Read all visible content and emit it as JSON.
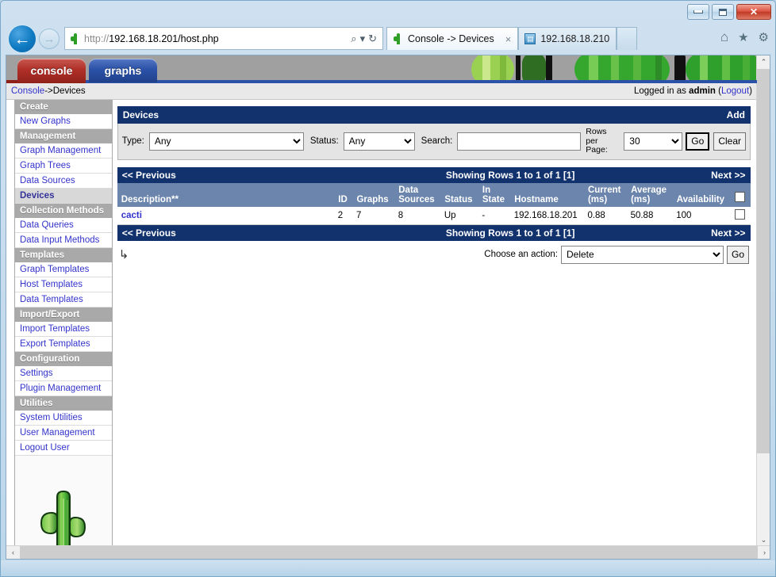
{
  "window": {
    "minimize_label": "Minimize",
    "restore_label": "Restore",
    "close_label": "Close"
  },
  "browser": {
    "back_glyph": "←",
    "forward_glyph": "→",
    "address_scheme": "http://",
    "address_rest": "192.168.18.201/host.php",
    "search_glyph": "⌕",
    "dropdown_glyph": "▾",
    "refresh_glyph": "↻",
    "home_glyph": "⌂",
    "favorites_glyph": "★",
    "settings_glyph": "⚙",
    "tabs": [
      {
        "title": "Console -> Devices",
        "close_glyph": "×",
        "favicon": "cactus-icon",
        "active": true
      },
      {
        "title": "192.168.18.210",
        "close_glyph": "",
        "favicon": "page-icon",
        "active": false
      }
    ]
  },
  "app": {
    "tabs": [
      {
        "label": "console",
        "color": "#b03028"
      },
      {
        "label": "graphs",
        "color": "#2b52a8"
      }
    ],
    "breadcrumb": {
      "root": "Console",
      "separator": " -> ",
      "current": "Devices"
    },
    "login": {
      "prefix": "Logged in as ",
      "user": "admin",
      "logout_open": " (",
      "logout": "Logout",
      "logout_close": ")"
    }
  },
  "sidebar": {
    "sections": [
      {
        "header": "Create",
        "items": [
          {
            "label": "New Graphs",
            "selected": false
          }
        ]
      },
      {
        "header": "Management",
        "items": [
          {
            "label": "Graph Management",
            "selected": false
          },
          {
            "label": "Graph Trees",
            "selected": false
          },
          {
            "label": "Data Sources",
            "selected": false
          },
          {
            "label": "Devices",
            "selected": true
          }
        ]
      },
      {
        "header": "Collection Methods",
        "items": [
          {
            "label": "Data Queries",
            "selected": false
          },
          {
            "label": "Data Input Methods",
            "selected": false
          }
        ]
      },
      {
        "header": "Templates",
        "items": [
          {
            "label": "Graph Templates",
            "selected": false
          },
          {
            "label": "Host Templates",
            "selected": false
          },
          {
            "label": "Data Templates",
            "selected": false
          }
        ]
      },
      {
        "header": "Import/Export",
        "items": [
          {
            "label": "Import Templates",
            "selected": false
          },
          {
            "label": "Export Templates",
            "selected": false
          }
        ]
      },
      {
        "header": "Configuration",
        "items": [
          {
            "label": "Settings",
            "selected": false
          },
          {
            "label": "Plugin Management",
            "selected": false
          }
        ]
      },
      {
        "header": "Utilities",
        "items": [
          {
            "label": "System Utilities",
            "selected": false
          },
          {
            "label": "User Management",
            "selected": false
          },
          {
            "label": "Logout User",
            "selected": false
          }
        ]
      }
    ]
  },
  "main": {
    "panel_title": "Devices",
    "add_label": "Add",
    "filter": {
      "type_label": "Type:",
      "type_value": "Any",
      "status_label": "Status:",
      "status_value": "Any",
      "search_label": "Search:",
      "search_value": "",
      "search_placeholder": "",
      "rows_per_page_label": "Rows per Page:",
      "rows_per_page_value": "30",
      "go_label": "Go",
      "clear_label": "Clear"
    },
    "pager": {
      "previous": "<< Previous",
      "showing": "Showing Rows 1 to 1 of 1 [1]",
      "next": "Next >>"
    },
    "table": {
      "columns": [
        "Description**",
        "ID",
        "Graphs",
        "Data Sources",
        "Status",
        "In State",
        "Hostname",
        "Current (ms)",
        "Average (ms)",
        "Availability"
      ],
      "rows": [
        {
          "description": "cacti",
          "id": "2",
          "graphs": "7",
          "data_sources": "8",
          "status": "Up",
          "in_state": "-",
          "hostname": "192.168.18.201",
          "current_ms": "0.88",
          "average_ms": "50.88",
          "availability": "100",
          "checked": false
        }
      ]
    },
    "action": {
      "arrow_glyph": "↳",
      "label": "Choose an action:",
      "value": "Delete",
      "go_label": "Go"
    }
  },
  "scroll": {
    "up_glyph": "⌃",
    "down_glyph": "⌄",
    "left_glyph": "‹",
    "right_glyph": "›"
  },
  "colors": {
    "panel_blue": "#12326e",
    "column_head": "#6c85ad",
    "link": "#3333cc",
    "status_up": "#3d8b3d",
    "menu_head": "#a9a9a9"
  }
}
